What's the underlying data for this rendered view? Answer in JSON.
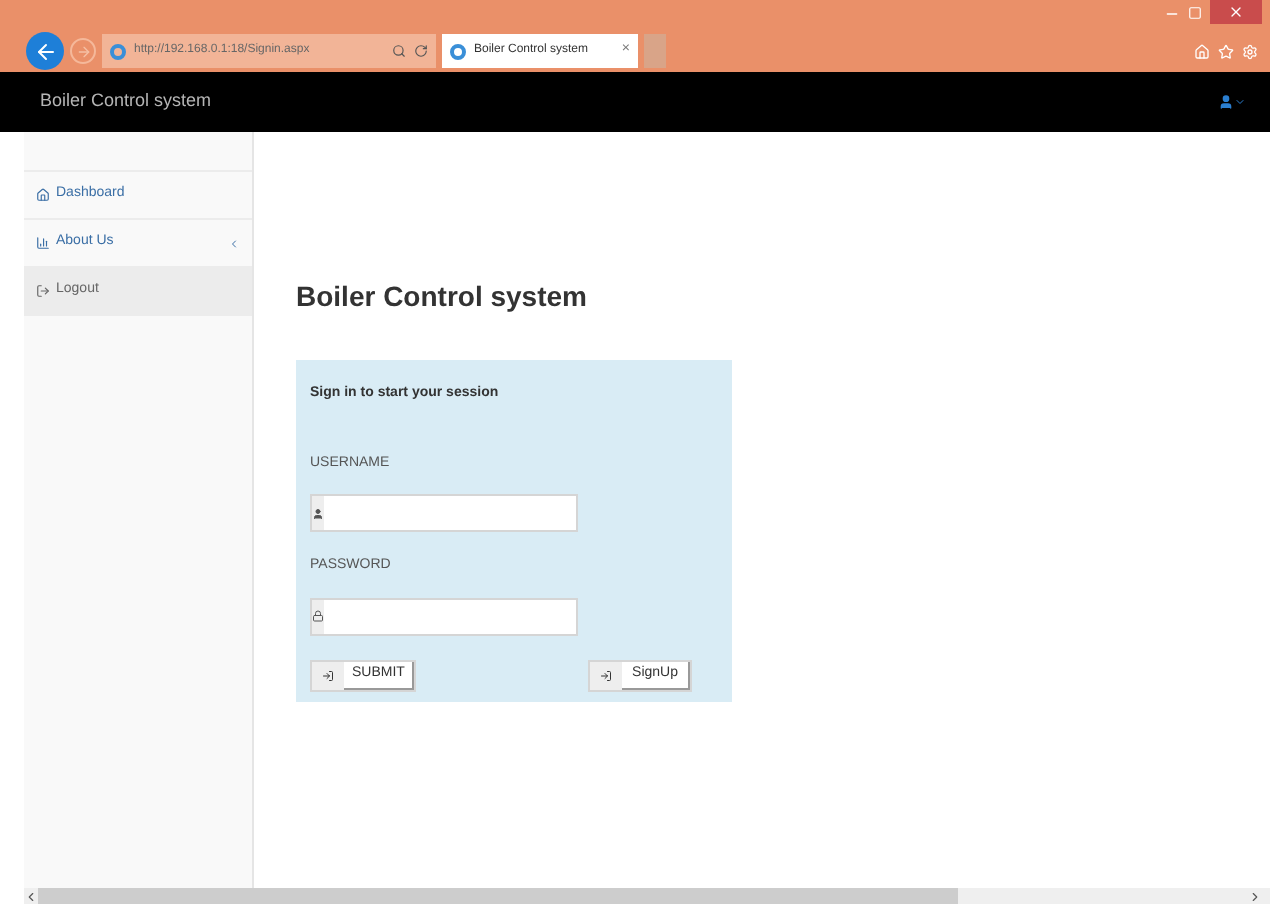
{
  "browser": {
    "address": "http://192.168.0.1:18/Signin.aspx",
    "tab_title": "Boiler Control system",
    "tab_close": "×"
  },
  "navbar": {
    "brand": "Boiler Control system"
  },
  "sidebar": {
    "items": [
      {
        "label": "Dashboard",
        "kind": "home",
        "selected": false,
        "expandable": false
      },
      {
        "label": "About Us",
        "kind": "chart",
        "selected": false,
        "expandable": true
      },
      {
        "label": "Logout",
        "kind": "logout",
        "selected": true,
        "expandable": false
      }
    ]
  },
  "page_title": "Boiler Control system",
  "login": {
    "heading": "Sign in to start your session",
    "username_label": "USERNAME",
    "password_label": "PASSWORD",
    "submit": "SUBMIT",
    "signup": "SignUp"
  }
}
